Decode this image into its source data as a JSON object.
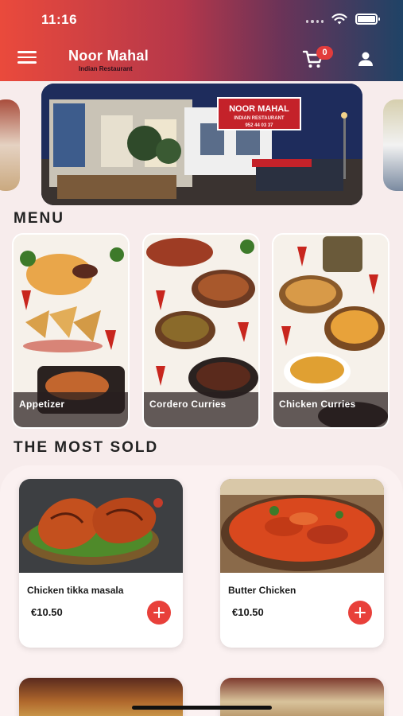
{
  "status_bar": {
    "time": "11:16"
  },
  "header": {
    "brand_name": "Noor Mahal",
    "brand_subtitle": "Indian Restaurant",
    "cart_count": "0",
    "icons": {
      "menu": "hamburger-menu-icon",
      "cart": "shopping-cart-icon",
      "user": "user-icon"
    }
  },
  "banner": {
    "sign_text_main": "NOOR MAHAL",
    "sign_text_sub": "INDIAN RESTAURANT",
    "sign_phone": "952 44 03 37"
  },
  "menu": {
    "title": "MENU",
    "categories": [
      {
        "label": "Appetizer"
      },
      {
        "label": "Cordero Curries"
      },
      {
        "label": "Chicken Curries"
      }
    ]
  },
  "most_sold": {
    "title": "THE MOST SOLD",
    "products": [
      {
        "name": "Chicken tikka masala",
        "price": "€10.50"
      },
      {
        "name": "Butter Chicken",
        "price": "€10.50"
      }
    ]
  },
  "colors": {
    "accent": "#e8403a",
    "header_start": "#ea4a3c",
    "header_end": "#1f4366"
  }
}
